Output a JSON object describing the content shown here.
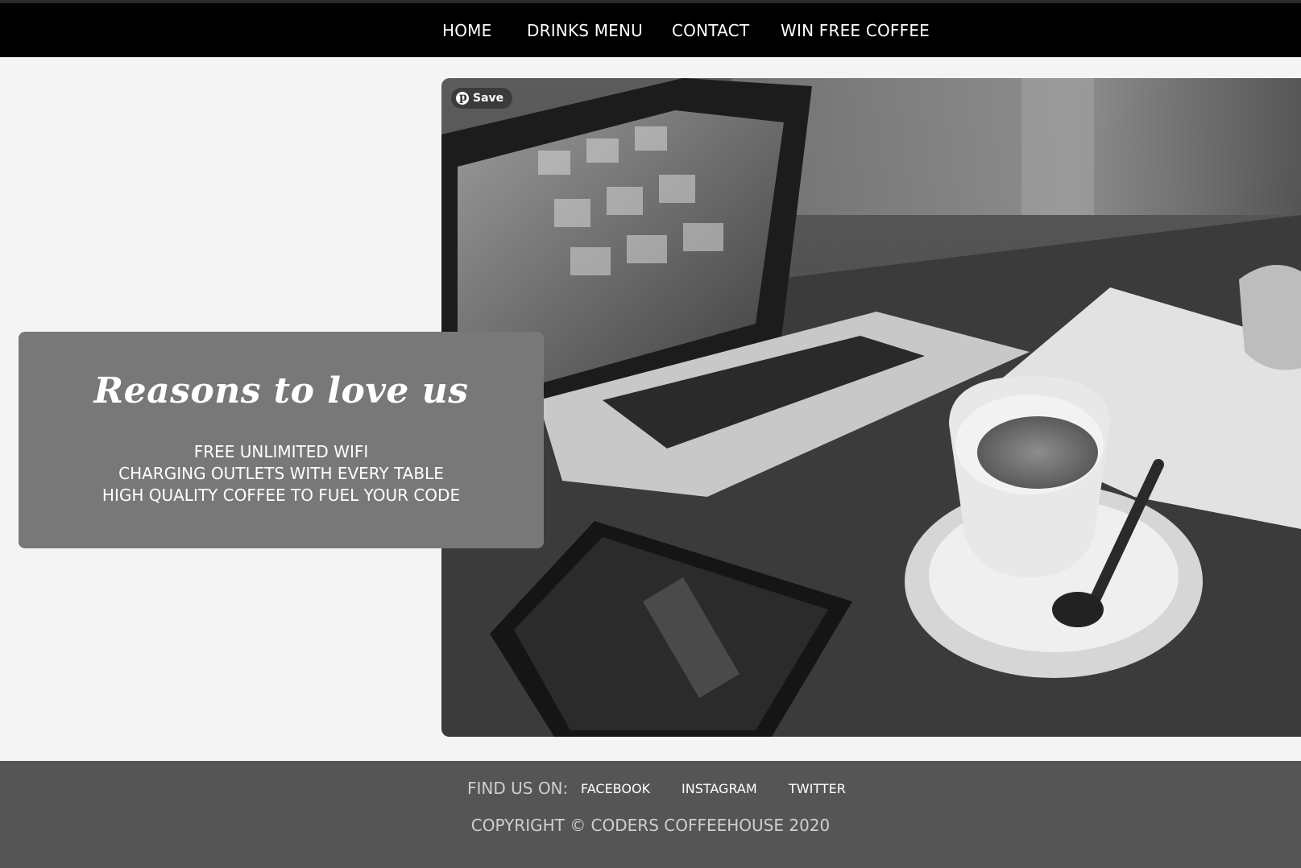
{
  "nav": {
    "items": [
      {
        "label": "HOME"
      },
      {
        "label": "DRINKS MENU"
      },
      {
        "label": "CONTACT"
      },
      {
        "label": "WIN FREE COFFEE"
      }
    ]
  },
  "hero": {
    "save_label": "Save",
    "save_icon": "pinterest-icon"
  },
  "reasons": {
    "title": "Reasons to love us",
    "items": [
      "FREE UNLIMITED WIFI",
      "CHARGING OUTLETS WITH EVERY TABLE",
      "HIGH QUALITY COFFEE TO FUEL YOUR CODE"
    ]
  },
  "footer": {
    "find_us_label": "FIND US ON:",
    "social": [
      "FACEBOOK",
      "INSTAGRAM",
      "TWITTER"
    ],
    "copyright": "COPYRIGHT © CODERS COFFEEHOUSE 2020"
  },
  "colors": {
    "nav_bg": "#000000",
    "page_bg": "#f4f4f4",
    "card_bg": "#787878",
    "footer_bg": "#555555"
  }
}
